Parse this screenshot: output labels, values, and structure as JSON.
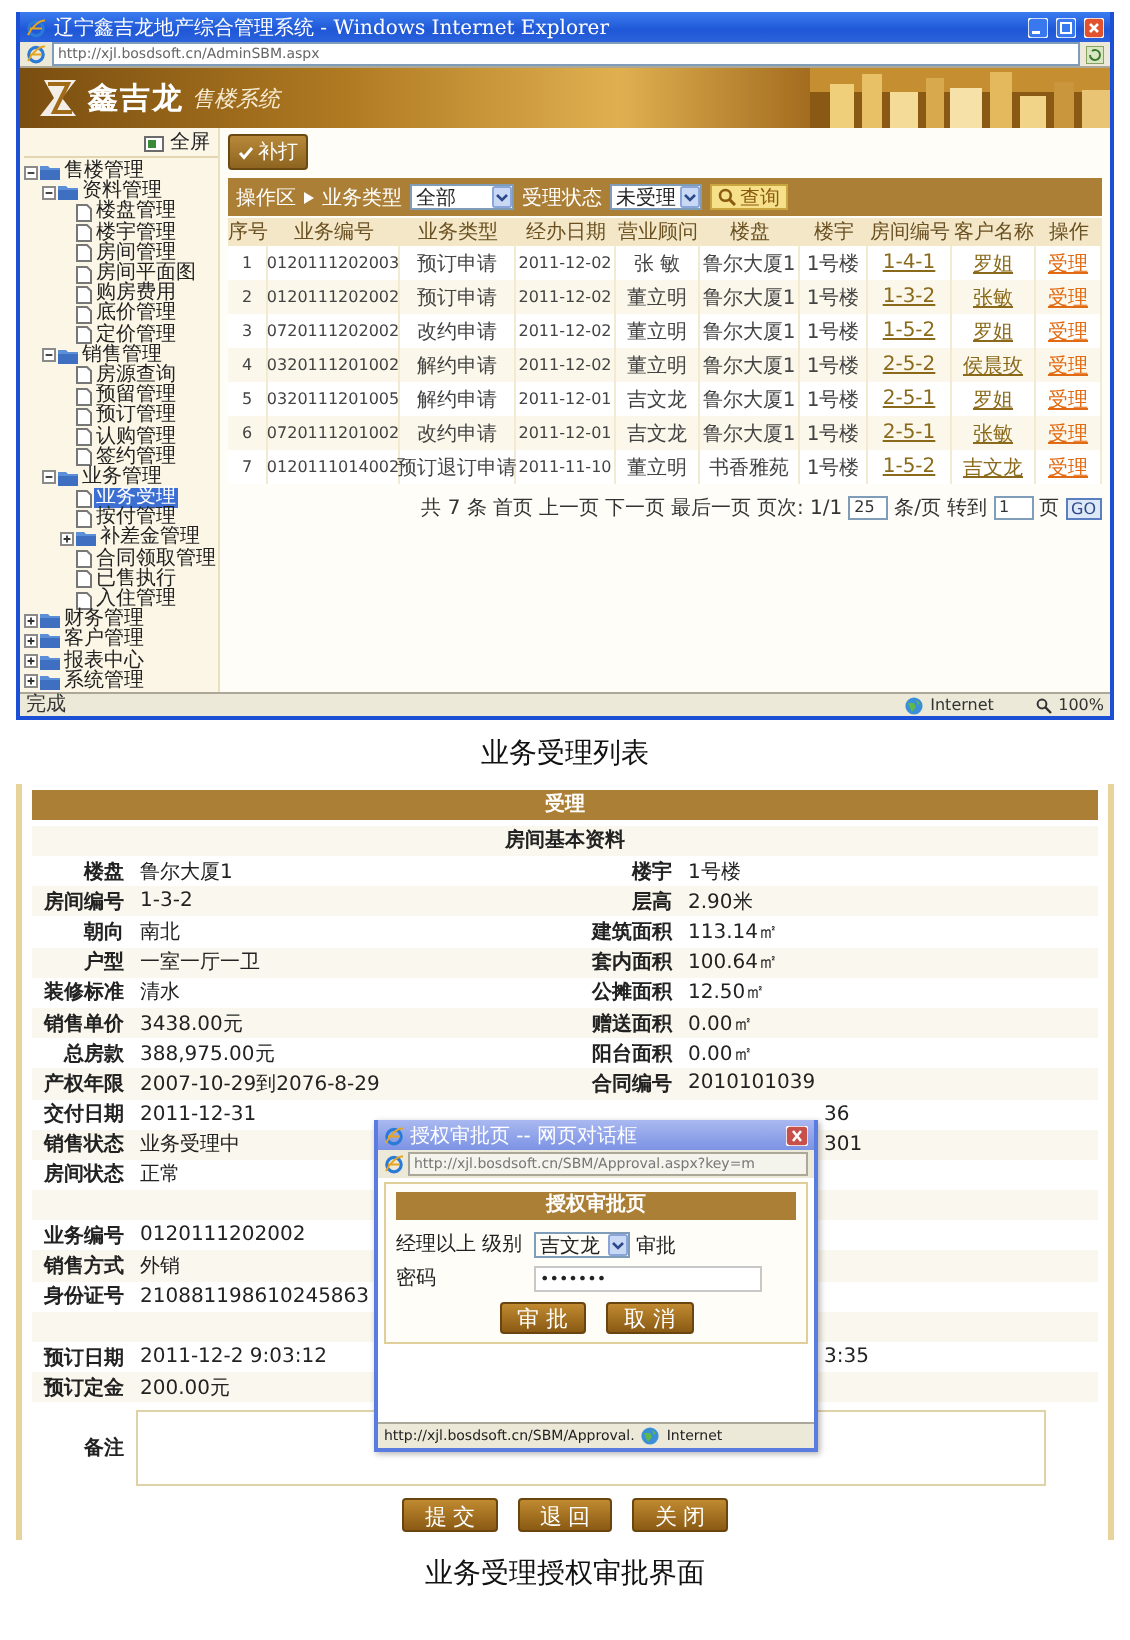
{
  "list_window": {
    "title": "辽宁鑫吉龙地产综合管理系统 - Windows Internet Explorer",
    "address": "http://xjl.bosdsoft.cn/AdminSBM.aspx",
    "brand": "鑫吉龙",
    "subtitle": "售楼系统",
    "fullscreen": "全屏",
    "reprint": "补打",
    "tree": [
      {
        "label": "售楼管理",
        "kind": "folder",
        "expanded": true,
        "selected": false,
        "children": [
          {
            "label": "资料管理",
            "kind": "folder",
            "expanded": true,
            "selected": false,
            "children": [
              {
                "label": "楼盘管理",
                "kind": "page",
                "selected": false
              },
              {
                "label": "楼宇管理",
                "kind": "page",
                "selected": false
              },
              {
                "label": "房间管理",
                "kind": "page",
                "selected": false
              },
              {
                "label": "房间平面图",
                "kind": "page",
                "selected": false
              },
              {
                "label": "购房费用",
                "kind": "page",
                "selected": false
              },
              {
                "label": "底价管理",
                "kind": "page",
                "selected": false
              },
              {
                "label": "定价管理",
                "kind": "page",
                "selected": false
              }
            ]
          },
          {
            "label": "销售管理",
            "kind": "folder",
            "expanded": true,
            "selected": false,
            "children": [
              {
                "label": "房源查询",
                "kind": "page",
                "selected": false
              },
              {
                "label": "预留管理",
                "kind": "page",
                "selected": false
              },
              {
                "label": "预订管理",
                "kind": "page",
                "selected": false
              },
              {
                "label": "认购管理",
                "kind": "page",
                "selected": false
              },
              {
                "label": "签约管理",
                "kind": "page",
                "selected": false
              }
            ]
          },
          {
            "label": "业务管理",
            "kind": "folder",
            "expanded": true,
            "selected": false,
            "children": [
              {
                "label": "业务受理",
                "kind": "page",
                "selected": true
              },
              {
                "label": "按付管理",
                "kind": "page",
                "selected": false
              },
              {
                "label": "补差金管理",
                "kind": "folder",
                "expanded": false,
                "selected": false
              },
              {
                "label": "合同领取管理",
                "kind": "page",
                "selected": false
              },
              {
                "label": "已售执行",
                "kind": "page",
                "selected": false
              },
              {
                "label": "入住管理",
                "kind": "page",
                "selected": false
              }
            ]
          }
        ]
      },
      {
        "label": "财务管理",
        "kind": "folder",
        "expanded": false,
        "selected": false
      },
      {
        "label": "客户管理",
        "kind": "folder",
        "expanded": false,
        "selected": false
      },
      {
        "label": "报表中心",
        "kind": "folder",
        "expanded": false,
        "selected": false
      },
      {
        "label": "系统管理",
        "kind": "folder",
        "expanded": false,
        "selected": false
      }
    ],
    "filter": {
      "area": "操作区",
      "type_label": "业务类型",
      "type_value": "全部",
      "status_label": "受理状态",
      "status_value": "未受理",
      "search": "查询"
    },
    "columns": [
      {
        "label": "序号",
        "kind": "index"
      },
      {
        "label": "业务编号",
        "kind": "number"
      },
      {
        "label": "业务类型",
        "kind": "text"
      },
      {
        "label": "经办日期",
        "kind": "number"
      },
      {
        "label": "营业顾问",
        "kind": "text"
      },
      {
        "label": "楼盘",
        "kind": "text"
      },
      {
        "label": "楼宇",
        "kind": "text"
      },
      {
        "label": "房间编号",
        "kind": "link"
      },
      {
        "label": "客户名称",
        "kind": "link"
      },
      {
        "label": "操作",
        "kind": "action"
      }
    ],
    "rows": [
      {
        "cells": [
          "1",
          "0120111202003",
          "预订申请",
          "2011-12-02",
          "张 敏",
          "鲁尔大厦1",
          "1号楼",
          "1-4-1",
          "罗姐",
          "受理"
        ]
      },
      {
        "cells": [
          "2",
          "0120111202002",
          "预订申请",
          "2011-12-02",
          "董立明",
          "鲁尔大厦1",
          "1号楼",
          "1-3-2",
          "张敏",
          "受理"
        ]
      },
      {
        "cells": [
          "3",
          "0720111202002",
          "改约申请",
          "2011-12-02",
          "董立明",
          "鲁尔大厦1",
          "1号楼",
          "1-5-2",
          "罗姐",
          "受理"
        ]
      },
      {
        "cells": [
          "4",
          "0320111201002",
          "解约申请",
          "2011-12-02",
          "董立明",
          "鲁尔大厦1",
          "1号楼",
          "2-5-2",
          "侯晨玫",
          "受理"
        ]
      },
      {
        "cells": [
          "5",
          "0320111201005",
          "解约申请",
          "2011-12-01",
          "吉文龙",
          "鲁尔大厦1",
          "1号楼",
          "2-5-1",
          "罗姐",
          "受理"
        ]
      },
      {
        "cells": [
          "6",
          "0720111201002",
          "改约申请",
          "2011-12-01",
          "吉文龙",
          "鲁尔大厦1",
          "1号楼",
          "2-5-1",
          "张敏",
          "受理"
        ]
      },
      {
        "cells": [
          "7",
          "0120111014002",
          "预订退订申请",
          "2011-11-10",
          "董立明",
          "书香雅苑",
          "1号楼",
          "1-5-2",
          "吉文龙",
          "受理"
        ]
      }
    ],
    "pager": {
      "summary": "共 7 条",
      "first": "首页",
      "prev": "上一页",
      "next": "下一页",
      "last": "最后一页",
      "page": "页次: 1/1",
      "size": "25",
      "size_unit": "条/页",
      "goto": "转到",
      "goto_value": "1",
      "goto_unit": "页",
      "go": "GO"
    },
    "status": {
      "left": "完成",
      "zone": "Internet",
      "zoom": "100%"
    }
  },
  "caption_1": "业务受理列表",
  "form": {
    "header": "受理",
    "section": "房间基本资料",
    "rows": [
      {
        "kind": "pair",
        "left_label": "楼盘",
        "left_value": "鲁尔大厦1",
        "right_label": "楼宇",
        "right_value": "1号楼"
      },
      {
        "kind": "pair",
        "left_label": "房间编号",
        "left_value": "1-3-2",
        "right_label": "层高",
        "right_value": "2.90米"
      },
      {
        "kind": "pair",
        "left_label": "朝向",
        "left_value": "南北",
        "right_label": "建筑面积",
        "right_value": "113.14㎡"
      },
      {
        "kind": "pair",
        "left_label": "户型",
        "left_value": "一室一厅一卫",
        "right_label": "套内面积",
        "right_value": "100.64㎡"
      },
      {
        "kind": "pair",
        "left_label": "装修标准",
        "left_value": "清水",
        "right_label": "公摊面积",
        "right_value": "12.50㎡"
      },
      {
        "kind": "pair",
        "left_label": "销售单价",
        "left_value": "3438.00元",
        "right_label": "赠送面积",
        "right_value": "0.00㎡"
      },
      {
        "kind": "pair",
        "left_label": "总房款",
        "left_value": "388,975.00元",
        "right_label": "阳台面积",
        "right_value": "0.00㎡"
      },
      {
        "kind": "pair",
        "left_label": "产权年限",
        "left_value": "2007-10-29到2076-8-29",
        "right_label": "合同编号",
        "right_value": "2010101039"
      },
      {
        "kind": "partial",
        "left_label": "交付日期",
        "left_value": "2011-12-31",
        "right_fragment": "36"
      },
      {
        "kind": "partial",
        "left_label": "销售状态",
        "left_value": "业务受理中",
        "right_fragment": "301"
      },
      {
        "kind": "single",
        "left_label": "房间状态",
        "left_value": "正常"
      },
      {
        "kind": "blank"
      },
      {
        "kind": "single",
        "left_label": "业务编号",
        "left_value": "0120111202002"
      },
      {
        "kind": "single",
        "left_label": "销售方式",
        "left_value": "外销"
      },
      {
        "kind": "single",
        "left_label": "身份证号",
        "left_value": "210881198610245863"
      },
      {
        "kind": "blank"
      },
      {
        "kind": "partial",
        "left_label": "预订日期",
        "left_value": "2011-12-2 9:03:12",
        "right_fragment": "3:35"
      },
      {
        "kind": "single",
        "left_label": "预订定金",
        "left_value": "200.00元"
      }
    ],
    "note_label": "备注",
    "buttons": [
      "提 交",
      "退 回",
      "关 闭"
    ]
  },
  "dialog": {
    "title": "授权审批页 -- 网页对话框",
    "address": "http://xjl.bosdsoft.cn/SBM/Approval.aspx?key=m",
    "header": "授权审批页",
    "level_label": "经理以上 级别",
    "approver": "吉文龙",
    "approve_word": "审批",
    "password_label": "密码",
    "password_mask": "•••••••",
    "buttons": [
      "审 批",
      "取 消"
    ],
    "status_url": "http://xjl.bosdsoft.cn/SBM/Approval.",
    "status_zone": "Internet"
  },
  "caption_2": "业务受理授权审批界面"
}
